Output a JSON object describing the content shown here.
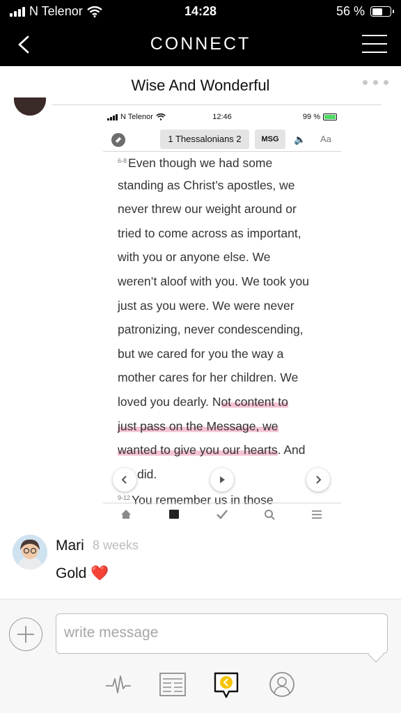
{
  "status_bar": {
    "carrier": "N Telenor",
    "time": "14:28",
    "battery": "56 %",
    "battery_level": 0.56
  },
  "nav": {
    "title": "CONNECT",
    "back_icon": "chevron-left-icon",
    "menu_icon": "hamburger-menu-icon"
  },
  "group": {
    "title": "Wise And Wonderful",
    "more_icon": "more-dots-icon"
  },
  "shared_screenshot": {
    "status": {
      "carrier": "N Telenor",
      "time": "12:46",
      "battery": "99 %"
    },
    "toolbar": {
      "book": "1 Thessalonians 2",
      "version": "MSG",
      "speaker_glyph": "🔈",
      "font_size_label": "Aa"
    },
    "passage": {
      "verse_ref_1": "6-8",
      "lines": [
        "Even though we had some",
        "standing as Christ’s apostles, we",
        "never threw our weight around or",
        "tried to come across as important,",
        "with you or anyone else. We",
        "weren’t aloof with you. We took you",
        "just as you were. We were never",
        "patronizing, never condescending,",
        "but we cared for you the way a",
        "mother cares for her children. We"
      ],
      "line11_plain": "loved you dearly. N",
      "line11_highlight": "ot content to",
      "line12_highlight": "just pass on the Message, we",
      "line13_highlight": "wanted to give you our hearts",
      "line13_plain": ". And",
      "line14": "did.",
      "verse_ref_2": "9-12",
      "line15": "You remember us in those"
    },
    "highlight_color": "#e05082"
  },
  "comment": {
    "author": "Mari",
    "time_ago": "8 weeks",
    "text": "Gold",
    "emoji": "❤️"
  },
  "composer": {
    "placeholder": "write message"
  },
  "bottom_tabs": [
    "activity-pulse-icon",
    "reader-news-icon",
    "connect-chat-icon",
    "profile-icon"
  ],
  "accent_color": "#f5c400"
}
